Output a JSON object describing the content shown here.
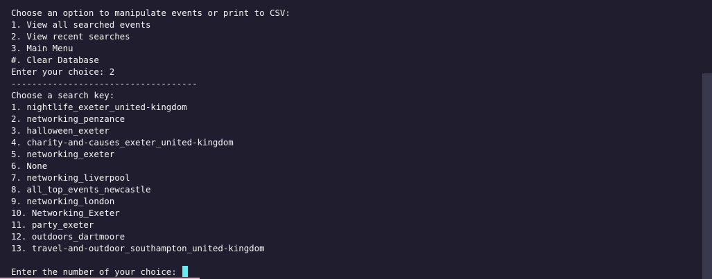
{
  "terminal": {
    "menu": {
      "prompt": "Choose an option to manipulate events or print to CSV:",
      "options": [
        "1. View all searched events",
        "2. View recent searches",
        "3. Main Menu",
        "#. Clear Database"
      ],
      "entered_choice": "Enter your choice: 2"
    },
    "separator": "------------------------------------",
    "search": {
      "heading": "Choose a search key:",
      "keys": [
        "1. nightlife_exeter_united-kingdom",
        "2. networking_penzance",
        "3. halloween_exeter",
        "4. charity-and-causes_exeter_united-kingdom",
        "5. networking_exeter",
        "6. None",
        "7. networking_liverpool",
        "8. all_top_events_newcastle",
        "9. networking_london",
        "10. Networking_Exeter",
        "11. party_exeter",
        "12. outdoors_dartmoore",
        "13. travel-and-outdoor_southampton_united-kingdom"
      ]
    },
    "input_prompt": "Enter the number of your choice: ",
    "colors": {
      "background": "#1f1d2e",
      "text": "#f4f4f6",
      "cursor": "#6ee7f0",
      "scrollbar_thumb": "#3a384c"
    }
  }
}
